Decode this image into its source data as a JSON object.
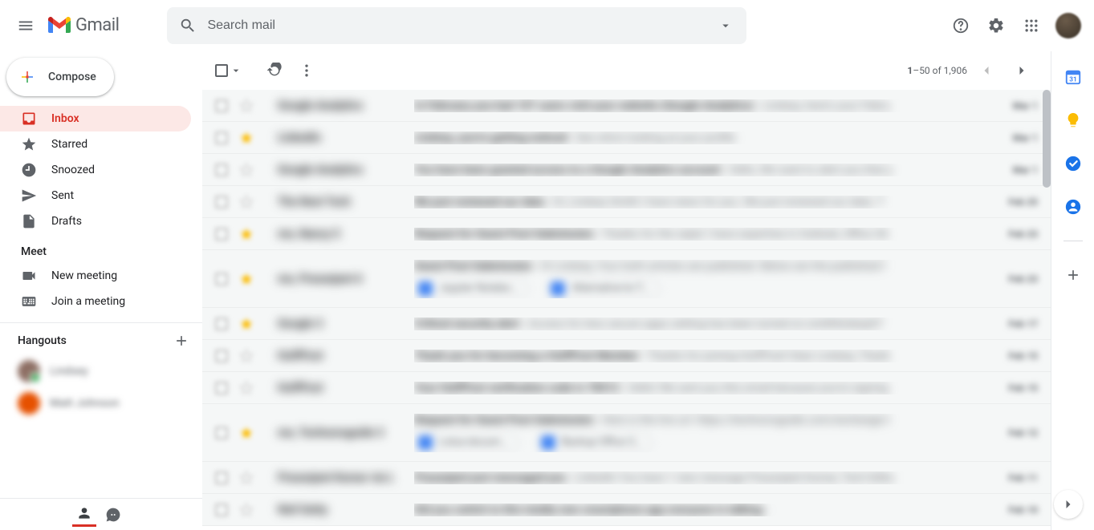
{
  "header": {
    "app_name": "Gmail",
    "search_placeholder": "Search mail"
  },
  "compose_label": "Compose",
  "nav": [
    {
      "icon": "inbox",
      "label": "Inbox",
      "active": true
    },
    {
      "icon": "star",
      "label": "Starred"
    },
    {
      "icon": "clock",
      "label": "Snoozed"
    },
    {
      "icon": "send",
      "label": "Sent"
    },
    {
      "icon": "file",
      "label": "Drafts"
    }
  ],
  "meet": {
    "label": "Meet",
    "items": [
      {
        "icon": "video",
        "label": "New meeting"
      },
      {
        "icon": "keyboard",
        "label": "Join a meeting"
      }
    ]
  },
  "hangouts": {
    "label": "Hangouts",
    "contacts": [
      {
        "name": "Lindsey",
        "avatar": "brown",
        "status": "green"
      },
      {
        "name": "Matt Johnson",
        "avatar": "orange",
        "status": "none"
      }
    ]
  },
  "toolbar": {
    "page_info_prefix": "1",
    "page_info_range": "–50",
    "page_info_of": " of ",
    "page_info_total": "1,906"
  },
  "emails": [
    {
      "starred": false,
      "sender": "Google Analytics",
      "subject": "In February you had 107 users visit your website (Google Analytics)",
      "snippet": "Lindsey, here's your Febru",
      "date": "Mar 1"
    },
    {
      "starred": true,
      "sender": "LinkedIn",
      "subject": "Lindsey, you're getting noticed",
      "snippet": "See who's looking at your profile",
      "date": "Mar 1"
    },
    {
      "starred": false,
      "sender": "Google Analytics",
      "subject": "You have been granted access to a Google Analytics account",
      "snippet": "Hello, We want to alert you that y",
      "date": "Mar 1"
    },
    {
      "starred": false,
      "sender": "The Next Tech",
      "subject": "We just reviewed our data",
      "snippet": "Hi, Lindsey Smith I have news for you. We just reviewed our data. T",
      "date": "Feb 25"
    },
    {
      "starred": true,
      "sender": "me, Nancy 5",
      "subject": "Request for Guest Post Submission",
      "snippet": "Thanks for the reply! I have expertise in Outlook, Office 36",
      "date": "Feb 23"
    },
    {
      "starred": true,
      "sender": "me, Prasanjeet 6",
      "subject": "Guest Post Submission",
      "snippet": "Hi Lindsey, Your both articles are published. Below are the published l",
      "date": "Feb 23",
      "chips": [
        "Jupyter Notebo...",
        "Alternative-to-T..."
      ]
    },
    {
      "starred": true,
      "sender": "Google 3",
      "subject": "Critical security alert",
      "snippet": "Access for less secure apps setting has been turned on smithlindsey07",
      "date": "Feb 17"
    },
    {
      "starred": false,
      "sender": "HuffPost",
      "subject": "Thank you for becoming a HuffPost Member",
      "snippet": "Thanks for joining HuffPost! Dear Lindsey, Thank",
      "date": "Feb 15"
    },
    {
      "starred": false,
      "sender": "HuffPost",
      "subject": "Your HuffPost verification code is 78412",
      "snippet": "Hello! We sent you this email because you're signing",
      "date": "Feb 15"
    },
    {
      "starred": true,
      "sender": "me, Technoroguide 3",
      "subject": "Request for Guest Post Submission",
      "snippet": "Here is the live url: https://technoroguide.com/exchange-t",
      "date": "Feb 12",
      "chips": [
        "Lotus-docum...",
        "Backup Office 3..."
      ]
    },
    {
      "starred": false,
      "sender": "Prasanjeet Kumar via L",
      "subject": "Prasanjeet just messaged you",
      "snippet": "LinkedIn You have 1 new message Prasanjeet Kumar, Tech Editu",
      "date": "Feb 11"
    },
    {
      "starred": false,
      "sender": "Neil Getty",
      "subject": "Did you switch to this totally new smartphone app everyone is talking",
      "snippet": "",
      "date": "Feb 10"
    }
  ]
}
